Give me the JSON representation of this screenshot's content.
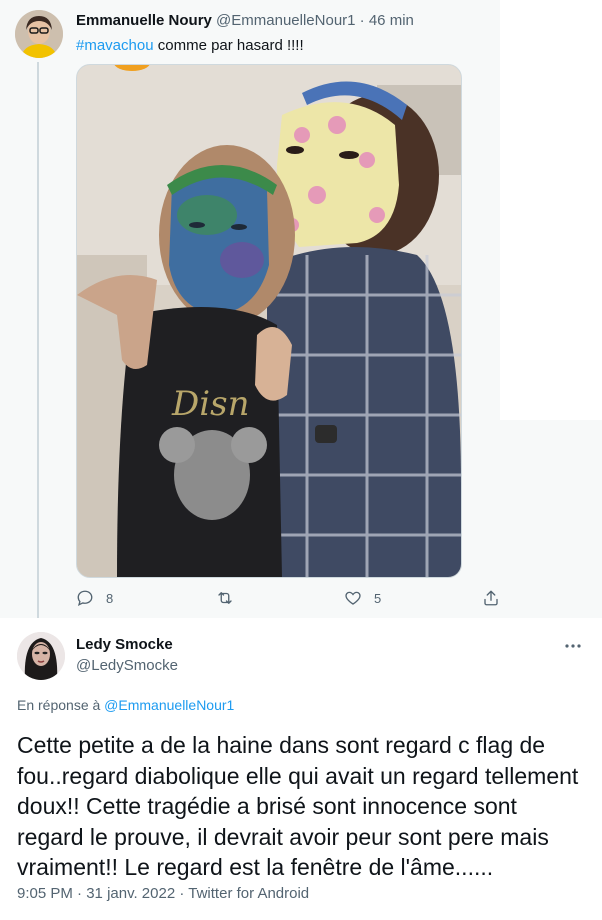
{
  "tweet1": {
    "display_name": "Emmanuelle Noury",
    "handle": "@EmmanuelleNour1",
    "separator": "·",
    "time": "46 min",
    "hashtag": "#mavachou",
    "text": " comme par hasard !!!!",
    "photo": "photo of two people wearing colorful sheet face masks",
    "actions": {
      "reply_icon": "reply-icon",
      "reply_count": "8",
      "retweet_icon": "retweet-icon",
      "like_icon": "heart-icon",
      "like_count": "5",
      "share_icon": "share-icon"
    }
  },
  "tweet2": {
    "display_name": "Ledy Smocke",
    "handle": "@LedySmocke",
    "more_icon": "more-dots-icon",
    "reply_prefix": "En réponse à ",
    "reply_handle": "@EmmanuelleNour1",
    "lines": [
      "Cette petite a de la haine dans sont regard c flag de",
      "fou..regard diabolique elle qui avait un regard tellement",
      "doux!! Cette tragédie a brisé sont innocence sont",
      "regard le prouve, il devrait avoir peur sont pere mais",
      "vraiment!! Le regard est la fenêtre de l'âme......"
    ],
    "time": "9:05 PM",
    "date": "31 janv. 2022",
    "source": "Twitter for Android",
    "separator": "·"
  },
  "colors": {
    "link": "#1d9bf0",
    "secondary_text": "#536471",
    "primary_text": "#0f1419",
    "tweet1_background": "#f7f9f9",
    "tweet2_background": "#ffffff"
  }
}
